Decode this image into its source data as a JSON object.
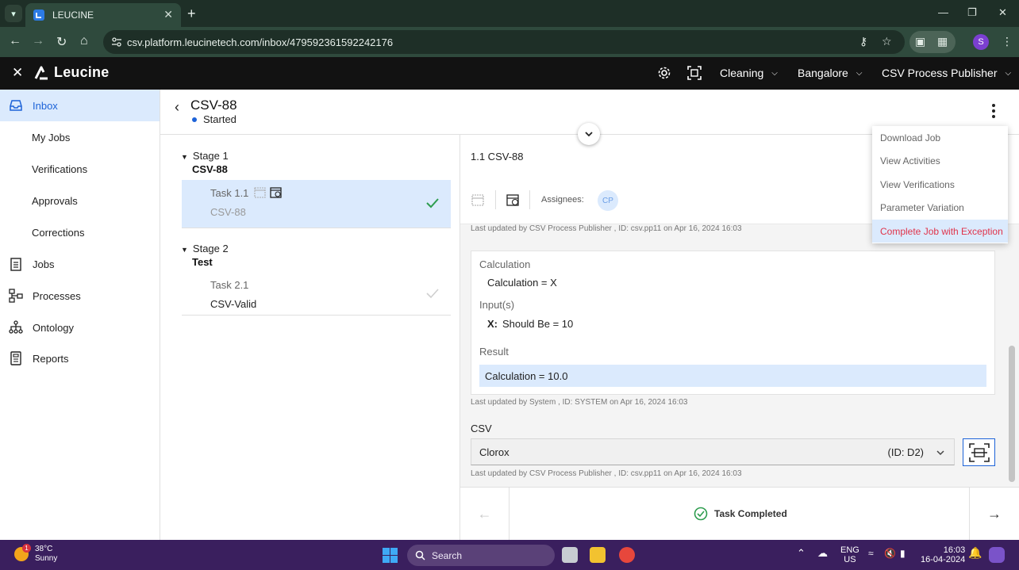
{
  "browser": {
    "tab_title": "LEUCINE",
    "url": "csv.platform.leucinetech.com/inbox/479592361592242176",
    "profile_initial": "S"
  },
  "header": {
    "logo_text": "Leucine",
    "facility": "Cleaning",
    "location": "Bangalore",
    "role": "CSV Process Publisher"
  },
  "sidebar": {
    "items": [
      {
        "label": "Inbox",
        "icon": "inbox-icon"
      },
      {
        "label": "My Jobs"
      },
      {
        "label": "Verifications"
      },
      {
        "label": "Approvals"
      },
      {
        "label": "Corrections"
      },
      {
        "label": "Jobs",
        "icon": "clipboard-icon"
      },
      {
        "label": "Processes",
        "icon": "flow-icon"
      },
      {
        "label": "Ontology",
        "icon": "hierarchy-icon"
      },
      {
        "label": "Reports",
        "icon": "report-icon"
      }
    ]
  },
  "job": {
    "title": "CSV-88",
    "status": "Started"
  },
  "stages": [
    {
      "label": "Stage 1",
      "name": "CSV-88",
      "task": {
        "label": "Task 1.1",
        "name": "CSV-88"
      }
    },
    {
      "label": "Stage 2",
      "name": "Test",
      "task": {
        "label": "Task 2.1",
        "name": "CSV-Valid"
      }
    }
  ],
  "task_panel": {
    "title": "1.1 CSV-88",
    "assignees_label": "Assignees:",
    "assignee_initials": "CP",
    "meta_top": "Last updated by CSV Process Publisher , ID: csv.pp11 on Apr 16, 2024 16:03",
    "calc": {
      "label": "Calculation",
      "expression": "Calculation = X",
      "inputs_label": "Input(s)",
      "input_var": "X:",
      "input_value": "Should Be = 10",
      "result_label": "Result",
      "result_value": "Calculation = 10.0"
    },
    "meta_calc": "Last updated by System , ID: SYSTEM on Apr 16, 2024 16:03",
    "csv_label": "CSV",
    "csv_value": "Clorox",
    "csv_id": "(ID: D2)",
    "meta_csv": "Last updated by CSV Process Publisher , ID: csv.pp11 on Apr 16, 2024 16:03",
    "footer_status": "Task Completed"
  },
  "menu": {
    "items": [
      {
        "label": "Download Job"
      },
      {
        "label": "View Activities"
      },
      {
        "label": "View Verifications"
      },
      {
        "label": "Parameter Variation"
      },
      {
        "label": "Complete Job with Exception"
      }
    ]
  },
  "taskbar": {
    "temperature": "38°C",
    "weather": "Sunny",
    "weather_badge": "1",
    "search_placeholder": "Search",
    "lang_top": "ENG",
    "lang_bottom": "US",
    "time": "16:03",
    "date": "16-04-2024"
  },
  "colors": {
    "accent": "#1d63d8",
    "active_bg": "#dbeafd",
    "danger": "#e0334a",
    "success": "#2e9d4f",
    "header_bg": "#121212"
  }
}
